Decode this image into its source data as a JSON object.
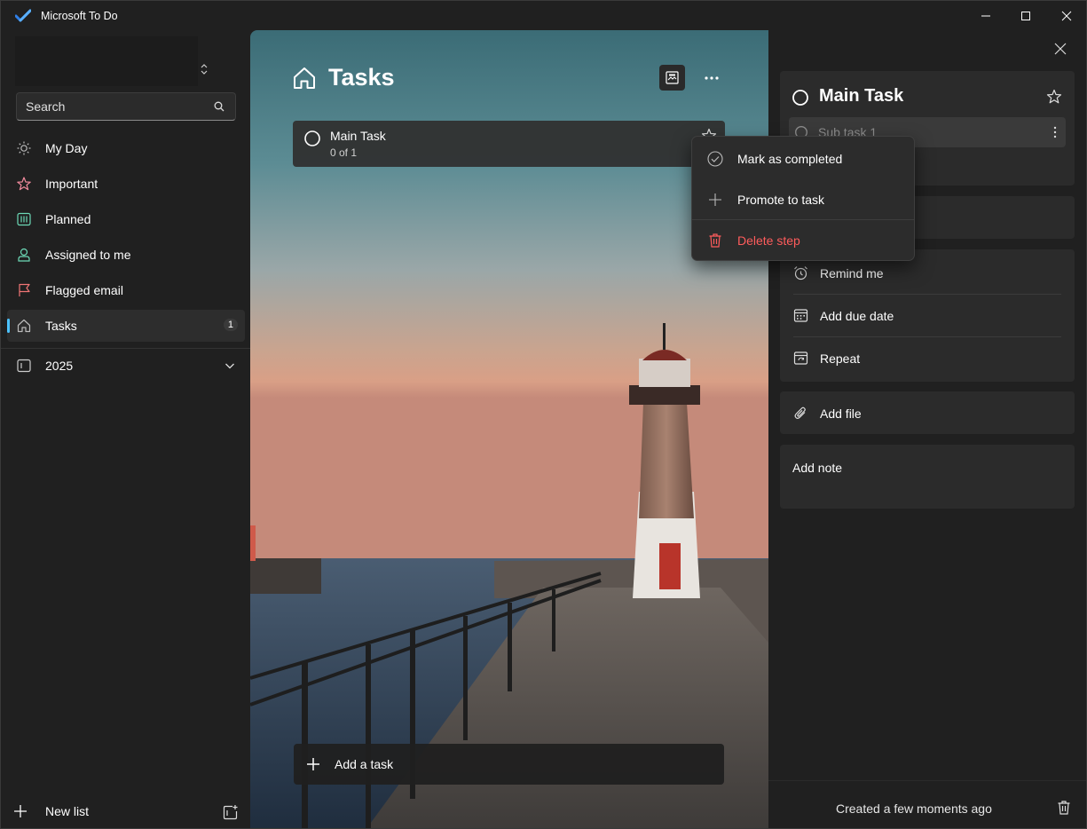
{
  "window": {
    "title": "Microsoft To Do"
  },
  "sidebar": {
    "search_placeholder": "Search",
    "items": [
      {
        "label": "My Day",
        "icon": "sun-icon"
      },
      {
        "label": "Important",
        "icon": "star-icon"
      },
      {
        "label": "Planned",
        "icon": "calendar-grid-icon"
      },
      {
        "label": "Assigned to me",
        "icon": "person-icon"
      },
      {
        "label": "Flagged email",
        "icon": "flag-icon"
      },
      {
        "label": "Tasks",
        "icon": "home-icon",
        "count": "1",
        "active": true
      }
    ],
    "group": {
      "label": "2025",
      "icon": "group-icon"
    },
    "new_list_label": "New list"
  },
  "main": {
    "list_title": "Tasks",
    "task": {
      "title": "Main Task",
      "progress": "0 of 1"
    },
    "add_task_label": "Add a task"
  },
  "detail": {
    "task_title": "Main Task",
    "step_label": "Sub task 1",
    "remind_label": "Remind me",
    "due_label": "Add due date",
    "repeat_label": "Repeat",
    "file_label": "Add file",
    "note_label": "Add note",
    "created_text": "Created a few moments ago"
  },
  "context_menu": {
    "items": [
      {
        "label": "Mark as completed",
        "icon": "check-circle-icon"
      },
      {
        "label": "Promote to task",
        "icon": "plus-icon"
      },
      {
        "label": "Delete step",
        "icon": "trash-icon",
        "color": "#ff5c5c"
      }
    ]
  },
  "colors": {
    "accent": "#4cc2ff",
    "danger": "#ff5c5c",
    "window_bg": "#202020",
    "card_bg": "#2b2b2b"
  }
}
